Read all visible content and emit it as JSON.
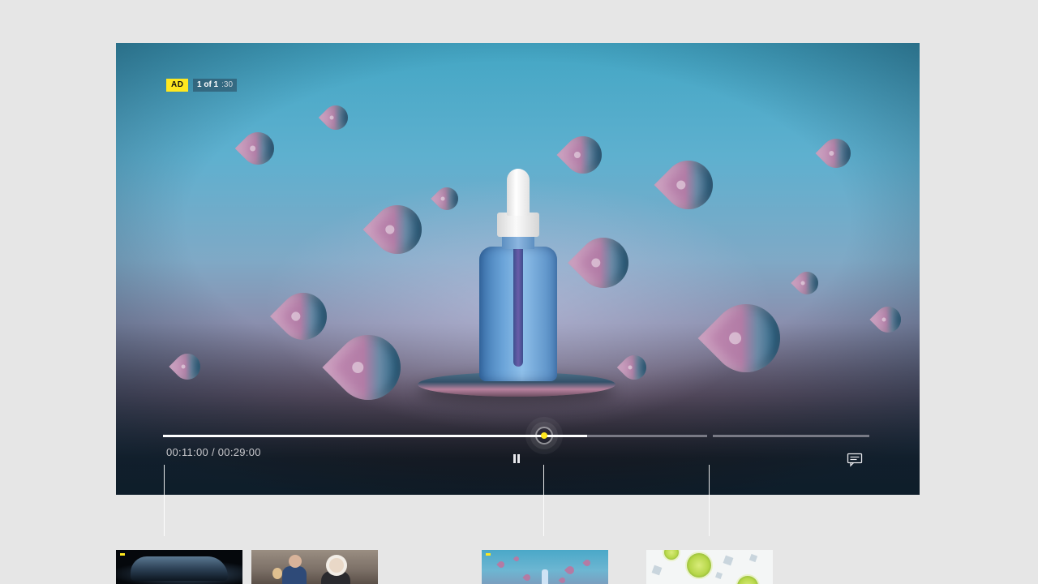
{
  "ad": {
    "badge": "AD",
    "position": "1 of 1",
    "remaining": ":30"
  },
  "player": {
    "timecode": "00:11:00 / 00:29:00",
    "progress_fraction": 0.78,
    "accent_color": "#ffe81f",
    "icons": {
      "pause": "pause-icon",
      "captions": "captions-icon"
    }
  },
  "thumbnails": [
    {
      "name": "car"
    },
    {
      "name": "people"
    },
    {
      "name": "ad-serum"
    },
    {
      "name": "limes"
    }
  ]
}
